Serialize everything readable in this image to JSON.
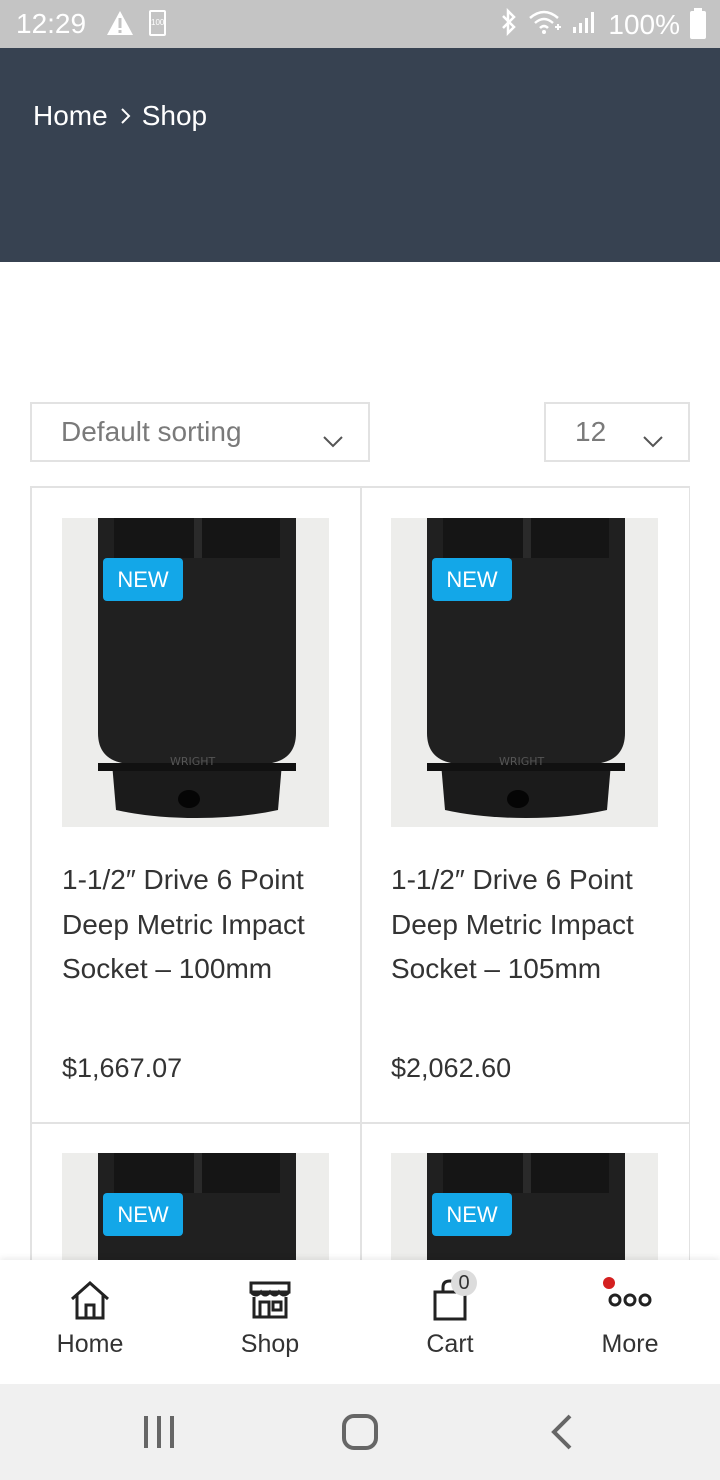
{
  "status_bar": {
    "time": "12:29",
    "battery_percent": "100%",
    "small_battery_text": "100"
  },
  "header": {
    "breadcrumb": [
      "Home",
      "Shop"
    ],
    "background_color": "#374251"
  },
  "sorting": {
    "sort_selected": "Default sorting",
    "per_page_selected": "12"
  },
  "products": [
    {
      "badge": "NEW",
      "title": "1-1/2″ Drive 6 Point Deep Metric Impact Socket – 100mm",
      "price": "$1,667.07"
    },
    {
      "badge": "NEW",
      "title": "1-1/2″ Drive 6 Point Deep Metric Impact Socket – 105mm",
      "price": "$2,062.60"
    },
    {
      "badge": "NEW",
      "title": "",
      "price": ""
    },
    {
      "badge": "NEW",
      "title": "",
      "price": ""
    }
  ],
  "bottom_nav": [
    {
      "label": "Home",
      "icon": "home-icon"
    },
    {
      "label": "Shop",
      "icon": "store-icon"
    },
    {
      "label": "Cart",
      "icon": "bag-icon"
    },
    {
      "label": "More",
      "icon": "more-icon"
    }
  ],
  "cart_count": "0",
  "colors": {
    "badge": "#13a7e8",
    "header": "#374251",
    "notification_dot": "#d42020"
  }
}
